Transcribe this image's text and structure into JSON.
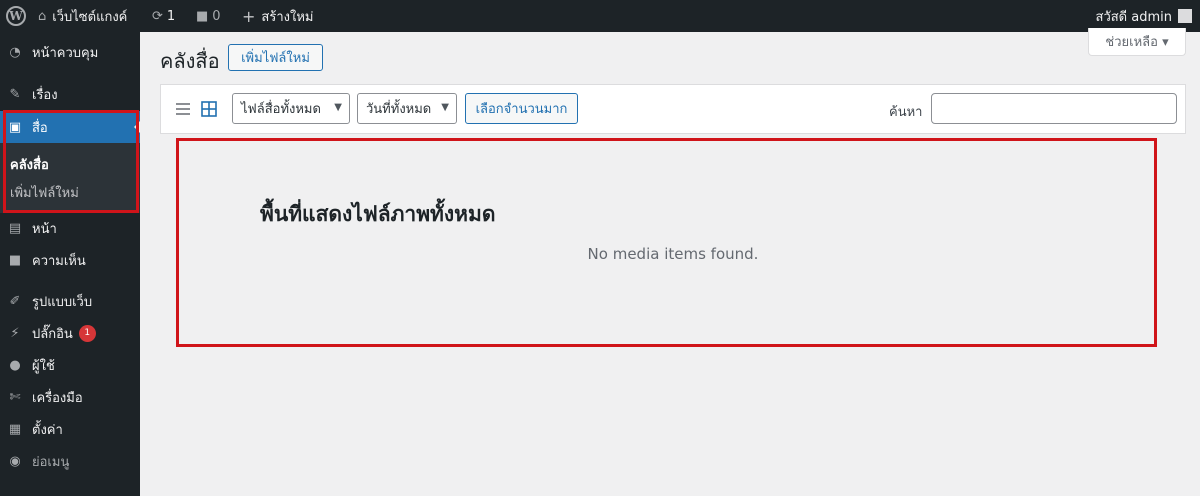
{
  "adminbar": {
    "site_name": "เว็บไซต์แกงค์",
    "updates_count": "1",
    "comments_count": "0",
    "new_label": "สร้างใหม่",
    "greeting": "สวัสดี admin"
  },
  "sidebar": {
    "items": [
      {
        "label": "หน้าควบคุม",
        "icon": "dashboard-icon"
      },
      {
        "label": "เรื่อง",
        "icon": "pin-icon"
      },
      {
        "label": "สื่อ",
        "icon": "media-icon"
      },
      {
        "label": "หน้า",
        "icon": "page-icon"
      },
      {
        "label": "ความเห็น",
        "icon": "comment-icon"
      },
      {
        "label": "รูปแบบเว็บ",
        "icon": "appearance-icon"
      },
      {
        "label": "ปลั๊กอิน",
        "icon": "plugin-icon"
      },
      {
        "label": "ผู้ใช้",
        "icon": "users-icon"
      },
      {
        "label": "เครื่องมือ",
        "icon": "tools-icon"
      },
      {
        "label": "ตั้งค่า",
        "icon": "settings-icon"
      },
      {
        "label": "ย่อเมนู",
        "icon": "collapse-icon"
      }
    ],
    "submenu": [
      "คลังสื่อ",
      "เพิ่มไฟล์ใหม่"
    ],
    "plugins_badge": "1"
  },
  "help": {
    "label": "ช่วยเหลือ ▾"
  },
  "page": {
    "title": "คลังสื่อ",
    "add_new": "เพิ่มไฟล์ใหม่"
  },
  "filters": {
    "media_type": "ไฟล์สื่อทั้งหมด",
    "dates": "วันที่ทั้งหมด",
    "bulk_select": "เลือกจำนวนมาก",
    "search_label": "ค้นหา",
    "search_value": ""
  },
  "content": {
    "area_heading": "พื้นที่แสดงไฟล์ภาพทั้งหมด",
    "empty_message": "No media items found."
  },
  "colors": {
    "highlight": "#d0141a",
    "accent": "#2271b1",
    "sidebar": "#1d2327"
  }
}
